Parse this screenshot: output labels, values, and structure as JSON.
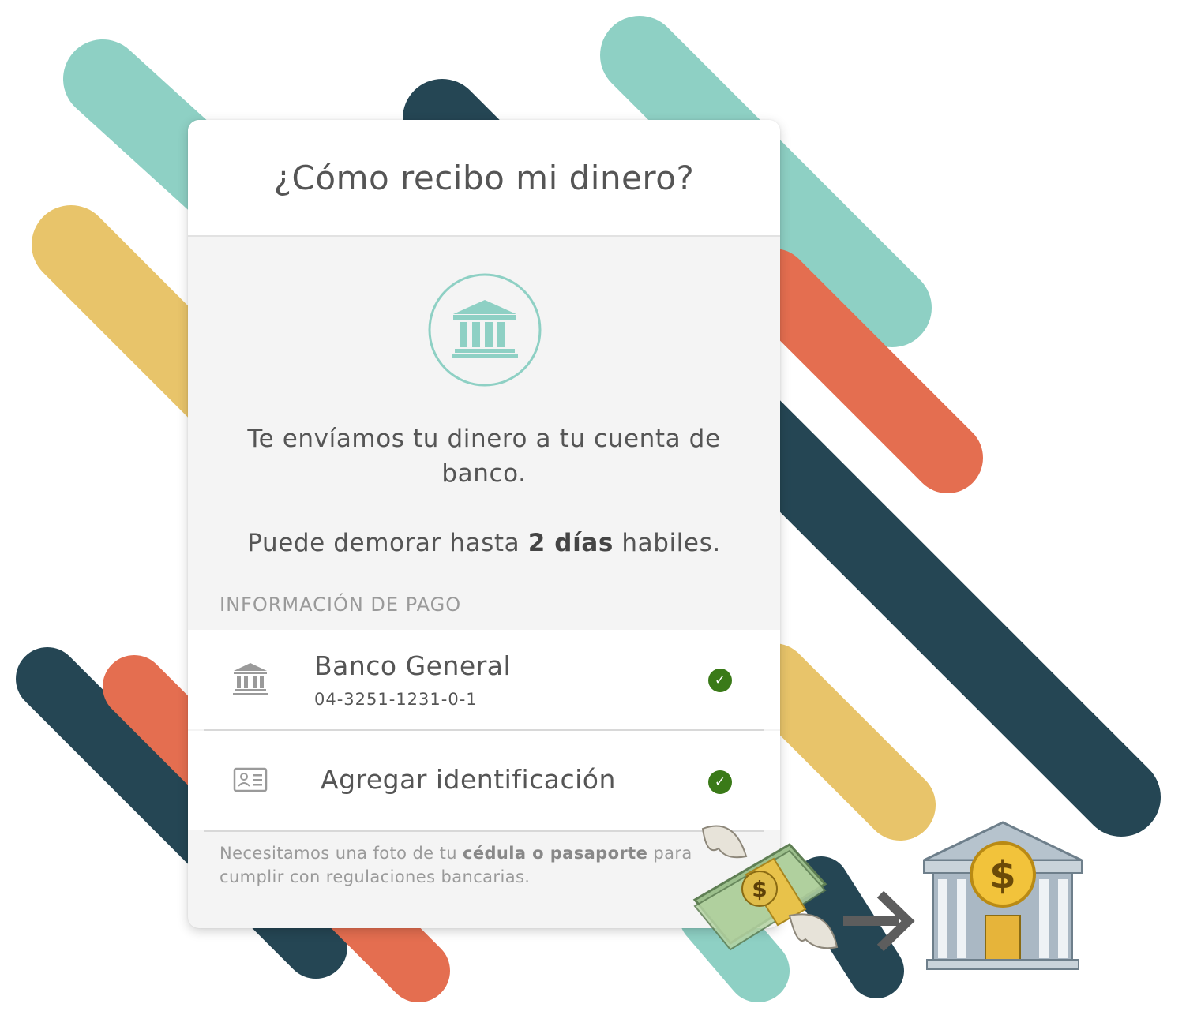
{
  "header": {
    "title": "¿Cómo recibo mi dinero?"
  },
  "hero": {
    "icon": "bank-icon"
  },
  "description": {
    "line1": "Te envíamos tu dinero a tu cuenta de banco.",
    "line2_prefix": "Puede demorar hasta ",
    "line2_bold": "2 días",
    "line2_suffix": " habiles."
  },
  "section": {
    "label": "INFORMACIÓN DE PAGO"
  },
  "payment_items": [
    {
      "icon": "bank-icon",
      "title": "Banco General",
      "subtitle": "04-3251-1231-0-1",
      "status_icon": "check-icon"
    },
    {
      "icon": "id-card-icon",
      "title": "Agregar identificación",
      "status_icon": "check-icon"
    }
  ],
  "footnote": {
    "prefix": "Necesitamos una foto de tu ",
    "bold": "cédula o pasaporte",
    "suffix": " para cumplir con regulaciones bancarias."
  },
  "colors": {
    "teal": "#8ed0c4",
    "navy": "#254654",
    "coral": "#e46e50",
    "yellow": "#e8c46a",
    "check_green": "#3a7a18"
  },
  "decoration": {
    "icons": [
      "money-with-wings-icon",
      "arrow-right-icon",
      "bank-building-icon"
    ]
  }
}
